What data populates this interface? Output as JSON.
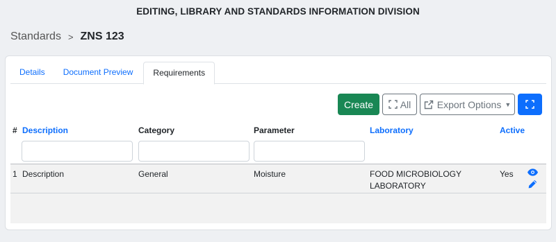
{
  "header": {
    "division_title": "EDITING, LIBRARY AND STANDARDS INFORMATION DIVISION"
  },
  "breadcrumb": {
    "root": "Standards",
    "separator": ">",
    "current": "ZNS 123"
  },
  "tabs": [
    {
      "label": "Details",
      "active": false
    },
    {
      "label": "Document Preview",
      "active": false
    },
    {
      "label": "Requirements",
      "active": true
    }
  ],
  "toolbar": {
    "create_label": "Create",
    "all_label": "All",
    "export_label": "Export Options",
    "expand_icon": "expand-icon",
    "export_icon": "external-link-icon",
    "fullscreen_icon": "fullscreen-icon"
  },
  "table": {
    "columns": [
      {
        "label": "#",
        "sortable": false
      },
      {
        "label": "Description",
        "sortable": true
      },
      {
        "label": "Category",
        "sortable": false
      },
      {
        "label": "Parameter",
        "sortable": false
      },
      {
        "label": "Laboratory",
        "sortable": true
      },
      {
        "label": "Active",
        "sortable": true
      }
    ],
    "rows": [
      {
        "num": "1",
        "description": "Description",
        "category": "General",
        "parameter": "Moisture",
        "laboratory": "FOOD MICROBIOLOGY LABORATORY",
        "active": "Yes",
        "actions": [
          "eye-icon",
          "pencil-icon"
        ]
      }
    ]
  },
  "colors": {
    "primary": "#0d6efd",
    "success": "#198754",
    "secondary": "#6c757d"
  }
}
